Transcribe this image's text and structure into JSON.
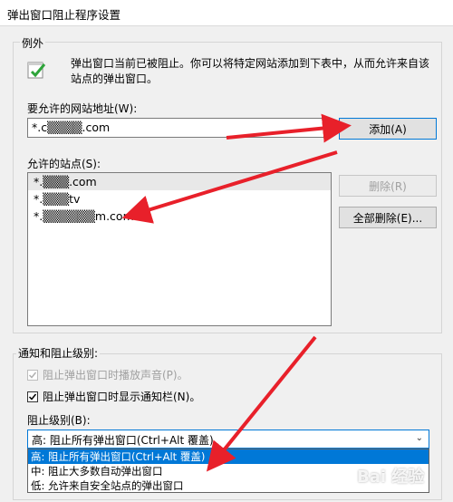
{
  "window": {
    "title": "弹出窗口阻止程序设置"
  },
  "exceptions": {
    "group_label": "例外",
    "info_text": "弹出窗口当前已被阻止。你可以将特定网站添加到下表中，从而允许来自该站点的弹出窗口。",
    "address_label": "要允许的网站地址(W):",
    "address_value": "*.c▒▒▒▒.com",
    "add_button": "添加(A)",
    "allowed_label": "允许的站点(S):",
    "allowed_sites": [
      "*.▒▒▒.com",
      "*.▒▒▒tv",
      "*.▒▒▒▒▒▒m.com"
    ],
    "remove_button": "删除(R)",
    "remove_all_button": "全部删除(E)..."
  },
  "notifications": {
    "group_label": "通知和阻止级别:",
    "sound_label": "阻止弹出窗口时播放声音(P)。",
    "bar_label": "阻止弹出窗口时显示通知栏(N)。",
    "level_label": "阻止级别(B):",
    "level_selected": "高: 阻止所有弹出窗口(Ctrl+Alt 覆盖)",
    "level_options": [
      "高: 阻止所有弹出窗口(Ctrl+Alt 覆盖)",
      "中: 阻止大多数自动弹出窗口",
      "低: 允许来自安全站点的弹出窗口"
    ]
  },
  "watermark": "Bai 经验",
  "colors": {
    "accent": "#0078d7",
    "arrow": "#e8202a"
  }
}
